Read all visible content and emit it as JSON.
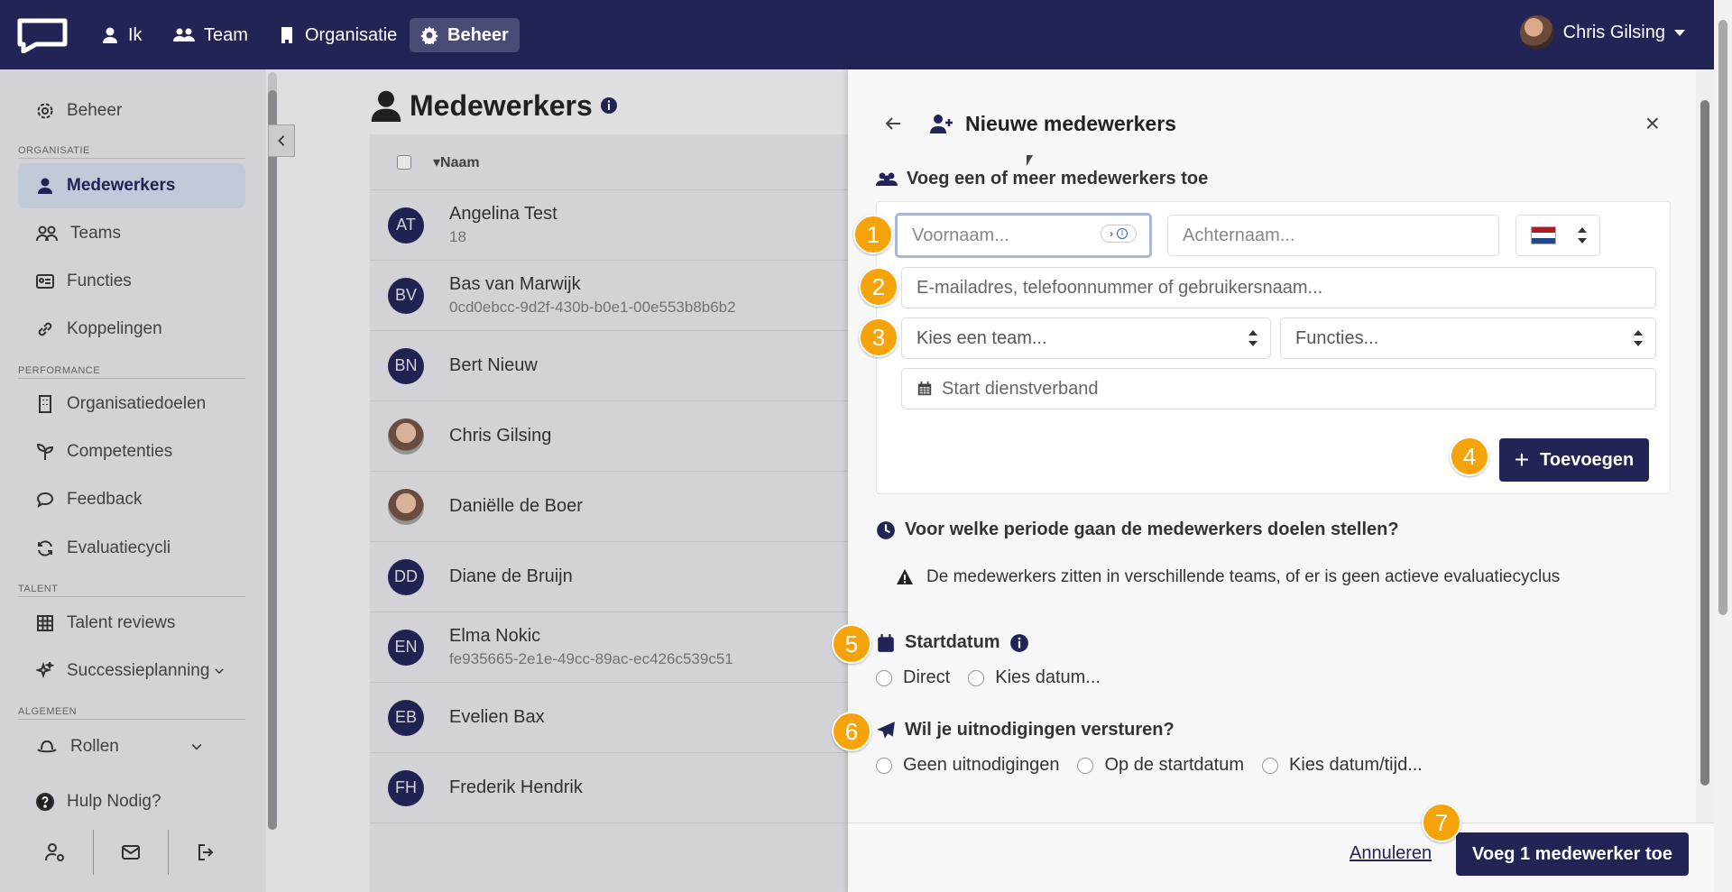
{
  "topnav": {
    "items": [
      {
        "label": "Ik",
        "icon": "user-icon"
      },
      {
        "label": "Team",
        "icon": "users-icon"
      },
      {
        "label": "Organisatie",
        "icon": "building-icon"
      },
      {
        "label": "Beheer",
        "icon": "gear-icon",
        "active": true
      }
    ],
    "user_name": "Chris Gilsing"
  },
  "sidebar": {
    "top_item": "Beheer",
    "sections": [
      {
        "title": "ORGANISATIE",
        "items": [
          "Medewerkers",
          "Teams",
          "Functies",
          "Koppelingen"
        ]
      },
      {
        "title": "PERFORMANCE",
        "items": [
          "Organisatiedoelen",
          "Competenties",
          "Feedback",
          "Evaluatiecycli"
        ]
      },
      {
        "title": "TALENT",
        "items": [
          "Talent reviews",
          "Successieplanning"
        ]
      },
      {
        "title": "ALGEMEEN",
        "items": [
          "Rollen"
        ]
      }
    ],
    "help": "Hulp Nodig?"
  },
  "main": {
    "title": "Medewerkers",
    "column_name": "Naam",
    "rows": [
      {
        "initials": "AT",
        "name": "Angelina Test",
        "sub": "18"
      },
      {
        "initials": "BV",
        "name": "Bas van Marwijk",
        "sub": "0cd0ebcc-9d2f-430b-b0e1-00e553b8b6b2"
      },
      {
        "initials": "BN",
        "name": "Bert Nieuw",
        "sub": ""
      },
      {
        "initials": "",
        "name": "Chris Gilsing",
        "sub": "",
        "photo": true
      },
      {
        "initials": "",
        "name": "Daniëlle de Boer",
        "sub": "",
        "photo": true
      },
      {
        "initials": "DD",
        "name": "Diane de Bruijn",
        "sub": ""
      },
      {
        "initials": "EN",
        "name": "Elma Nokic",
        "sub": "fe935665-2e1e-49cc-89ac-ec426c539c51"
      },
      {
        "initials": "EB",
        "name": "Evelien Bax",
        "sub": ""
      },
      {
        "initials": "FH",
        "name": "Frederik Hendrik",
        "sub": ""
      }
    ]
  },
  "panel": {
    "title": "Nieuwe medewerkers",
    "add_section_title": "Voeg een of meer medewerkers toe",
    "firstname_placeholder": "Voornaam...",
    "lastname_placeholder": "Achternaam...",
    "contact_placeholder": "E-mailadres, telefoonnummer of gebruikersnaam...",
    "team_select": "Kies een team...",
    "functions_select": "Functies...",
    "start_placeholder": "Start dienstverband",
    "add_button": "Toevoegen",
    "period_title": "Voor welke periode gaan de medewerkers doelen stellen?",
    "warning": "De medewerkers zitten in verschillende teams, of er is geen actieve evaluatiecyclus",
    "startdate_title": "Startdatum",
    "startdate_options": [
      "Direct",
      "Kies datum..."
    ],
    "invite_title": "Wil je uitnodigingen versturen?",
    "invite_options": [
      "Geen uitnodigingen",
      "Op de startdatum",
      "Kies datum/tijd..."
    ],
    "cancel": "Annuleren",
    "submit": "Voeg 1 medewerker toe"
  },
  "badges": [
    "1",
    "2",
    "3",
    "4",
    "5",
    "6",
    "7"
  ],
  "colors": {
    "brand": "#222456",
    "badge": "#f5a30a"
  }
}
